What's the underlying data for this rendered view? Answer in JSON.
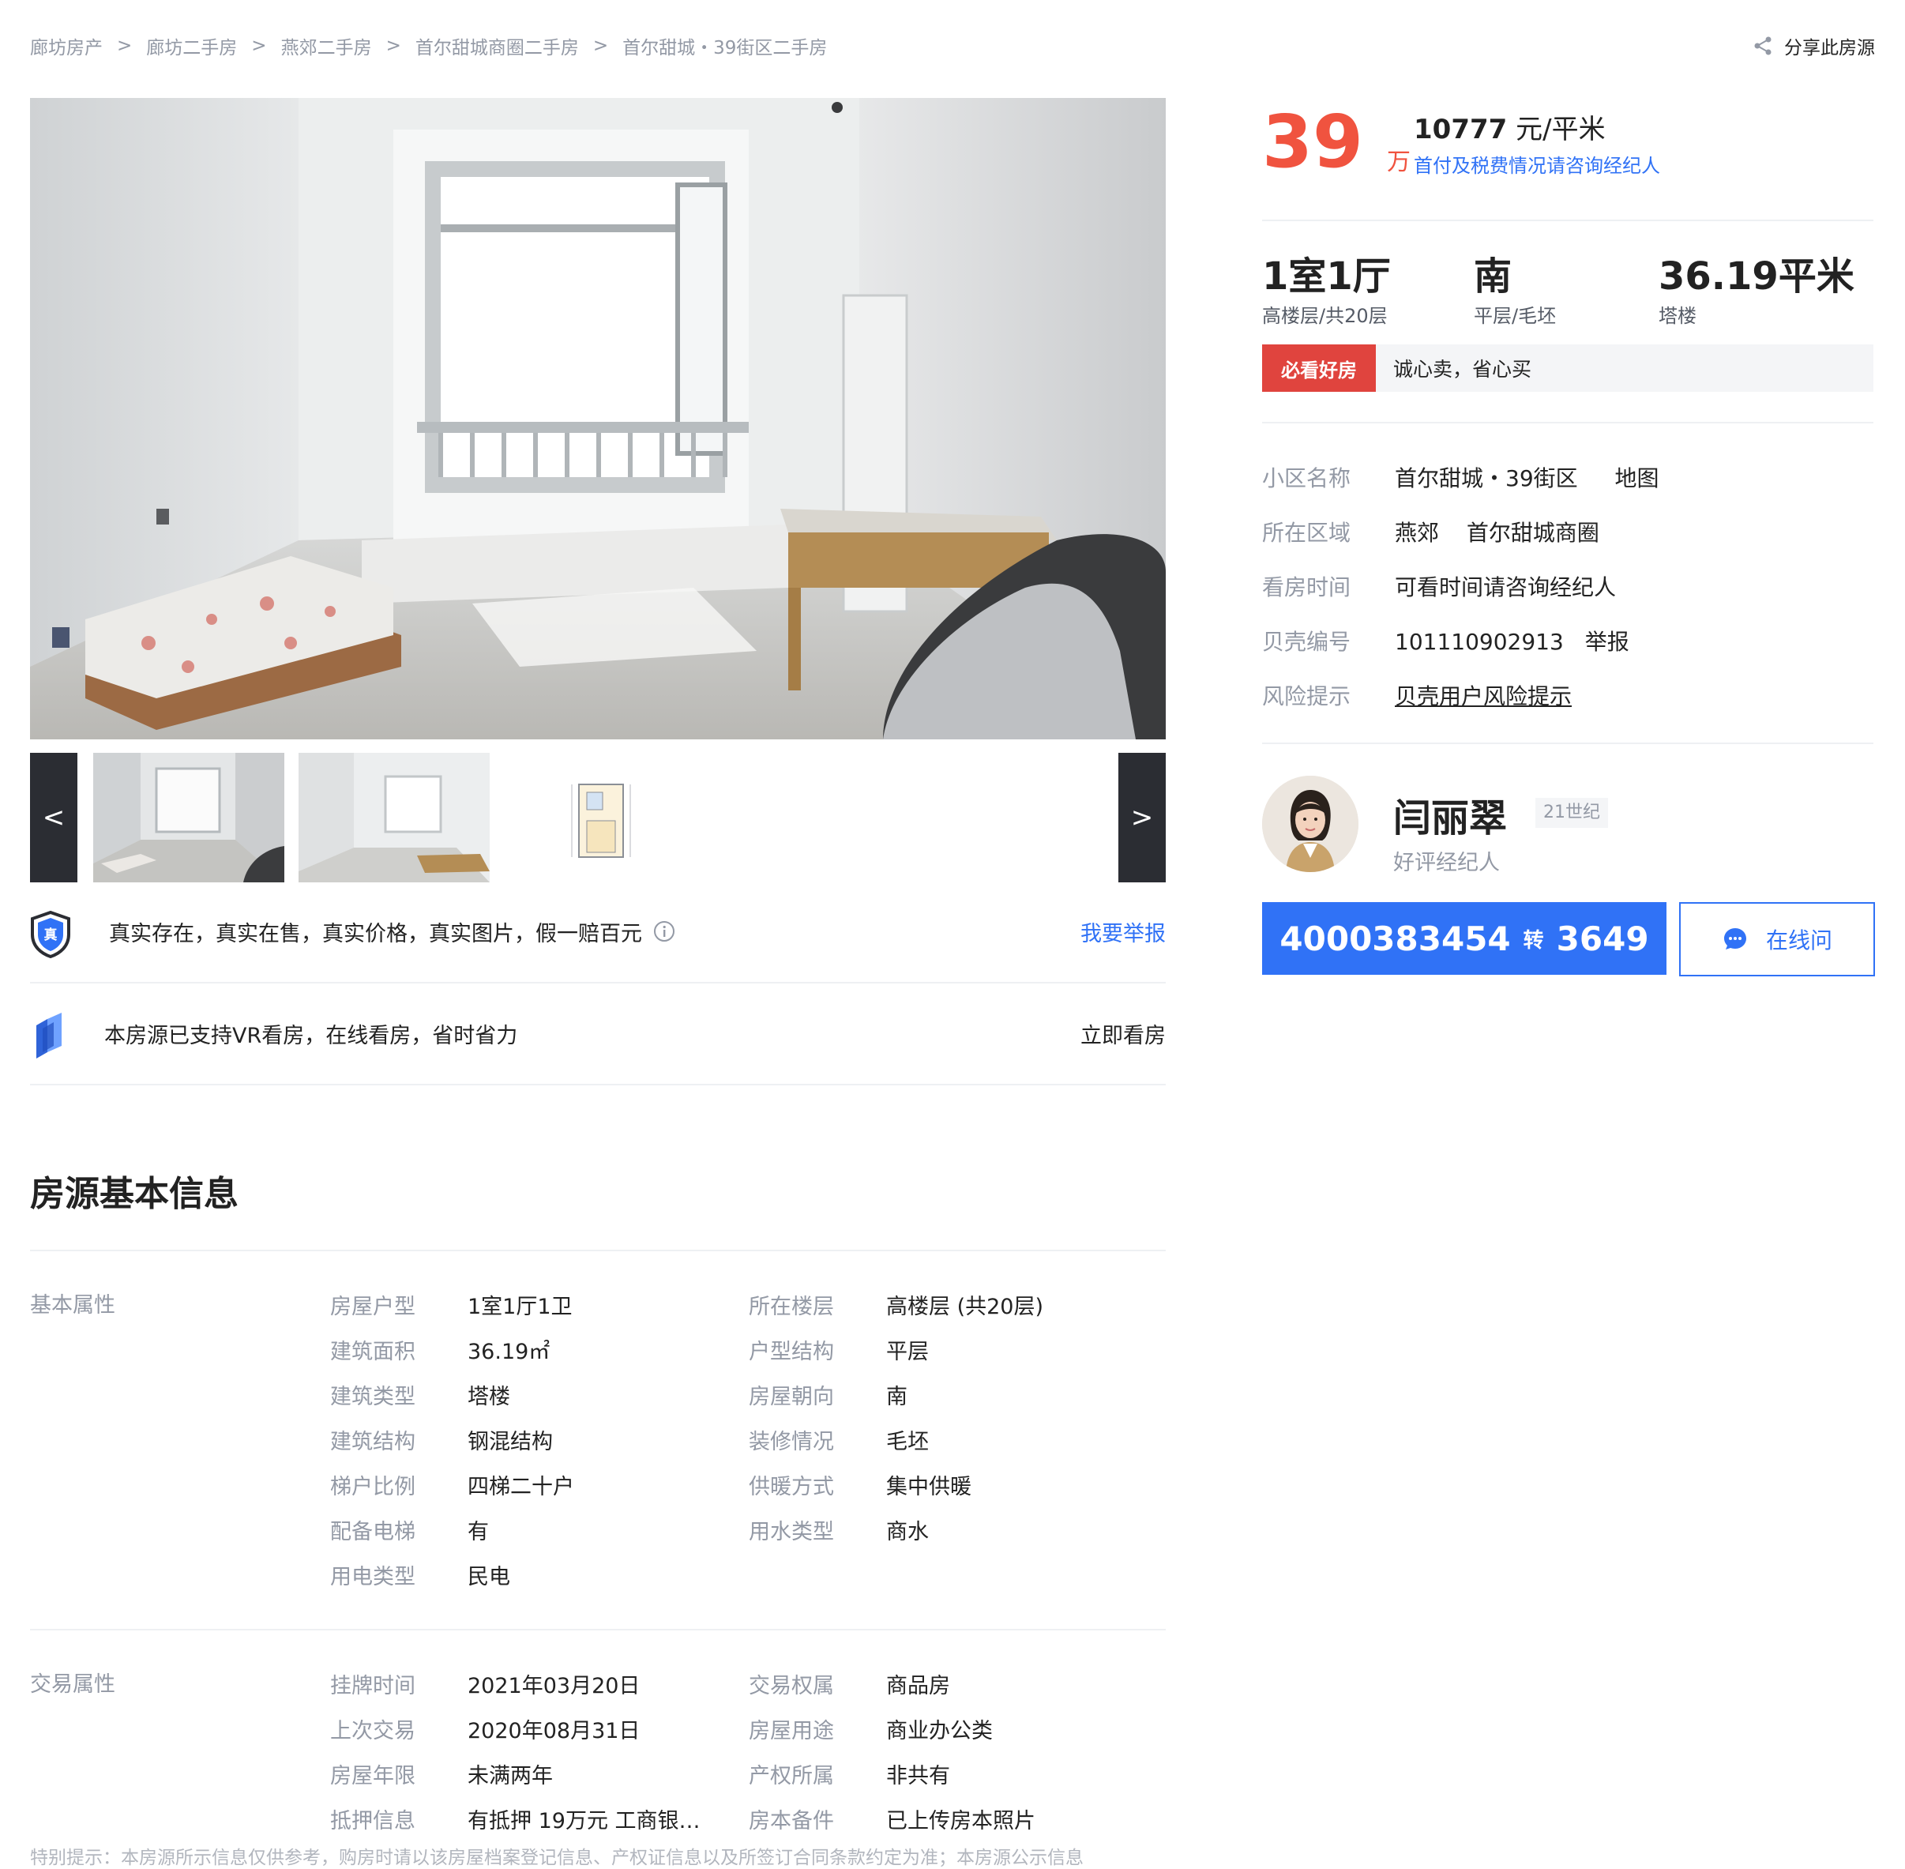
{
  "breadcrumb": [
    "廊坊房产",
    "廊坊二手房",
    "燕郊二手房",
    "首尔甜城商圈二手房",
    "首尔甜城・39街区二手房"
  ],
  "breadcrumb_sep": ">",
  "share_label": "分享此房源",
  "gallery": {
    "prev": "<",
    "next": ">"
  },
  "guarantee": {
    "badge": "真",
    "text": "真实存在，真实在售，真实价格，真实图片，假一赔百元",
    "report": "我要举报"
  },
  "vr": {
    "text": "本房源已支持VR看房，在线看房，省时省力",
    "action": "立即看房"
  },
  "price": {
    "total": "39",
    "total_unit": "万",
    "unit_value": "10777",
    "unit_label": "元/平米",
    "payment_link": "首付及税费情况请咨询经纪人"
  },
  "stats": [
    {
      "main": "1室1厅",
      "sub": "高楼层/共20层"
    },
    {
      "main": "南",
      "sub": "平层/毛坯"
    },
    {
      "main": "36.19平米",
      "sub": "塔楼"
    }
  ],
  "tag": {
    "label": "必看好房",
    "text": "诚心卖，省心买"
  },
  "details": {
    "community_label": "小区名称",
    "community": "首尔甜城・39街区",
    "map": "地图",
    "area_label": "所在区域",
    "area1": "燕郊",
    "area2": "首尔甜城商圈",
    "visit_label": "看房时间",
    "visit": "可看时间请咨询经纪人",
    "id_label": "贝壳编号",
    "id": "101110902913",
    "report": "举报",
    "risk_label": "风险提示",
    "risk": "贝壳用户风险提示"
  },
  "agent": {
    "name": "闫丽翠",
    "company": "21世纪",
    "role": "好评经纪人",
    "phone": "4000383454",
    "ext_label": "转",
    "ext": "3649",
    "chat": "在线问"
  },
  "section_title": "房源基本信息",
  "basic": {
    "category": "基本属性",
    "left": [
      {
        "label": "房屋户型",
        "value": "1室1厅1卫"
      },
      {
        "label": "建筑面积",
        "value": "36.19㎡"
      },
      {
        "label": "建筑类型",
        "value": "塔楼"
      },
      {
        "label": "建筑结构",
        "value": "钢混结构"
      },
      {
        "label": "梯户比例",
        "value": "四梯二十户"
      },
      {
        "label": "配备电梯",
        "value": "有"
      },
      {
        "label": "用电类型",
        "value": "民电"
      }
    ],
    "right": [
      {
        "label": "所在楼层",
        "value": "高楼层 (共20层)"
      },
      {
        "label": "户型结构",
        "value": "平层"
      },
      {
        "label": "房屋朝向",
        "value": "南"
      },
      {
        "label": "装修情况",
        "value": "毛坯"
      },
      {
        "label": "供暖方式",
        "value": "集中供暖"
      },
      {
        "label": "用水类型",
        "value": "商水"
      }
    ]
  },
  "trade": {
    "category": "交易属性",
    "left": [
      {
        "label": "挂牌时间",
        "value": "2021年03月20日"
      },
      {
        "label": "上次交易",
        "value": "2020年08月31日"
      },
      {
        "label": "房屋年限",
        "value": "未满两年"
      },
      {
        "label": "抵押信息",
        "value": "有抵押 19万元 工商银…"
      }
    ],
    "right": [
      {
        "label": "交易权属",
        "value": "商品房"
      },
      {
        "label": "房屋用途",
        "value": "商业办公类"
      },
      {
        "label": "产权所属",
        "value": "非共有"
      },
      {
        "label": "房本备件",
        "value": "已上传房本照片"
      }
    ]
  },
  "footer_note": "特别提示：本房源所示信息仅供参考，购房时请以该房屋档案登记信息、产权证信息以及所签订合同条款约定为准；本房源公示信息",
  "colors": {
    "accent": "#3072f6",
    "price": "#f0533f",
    "tag": "#e0443e"
  }
}
